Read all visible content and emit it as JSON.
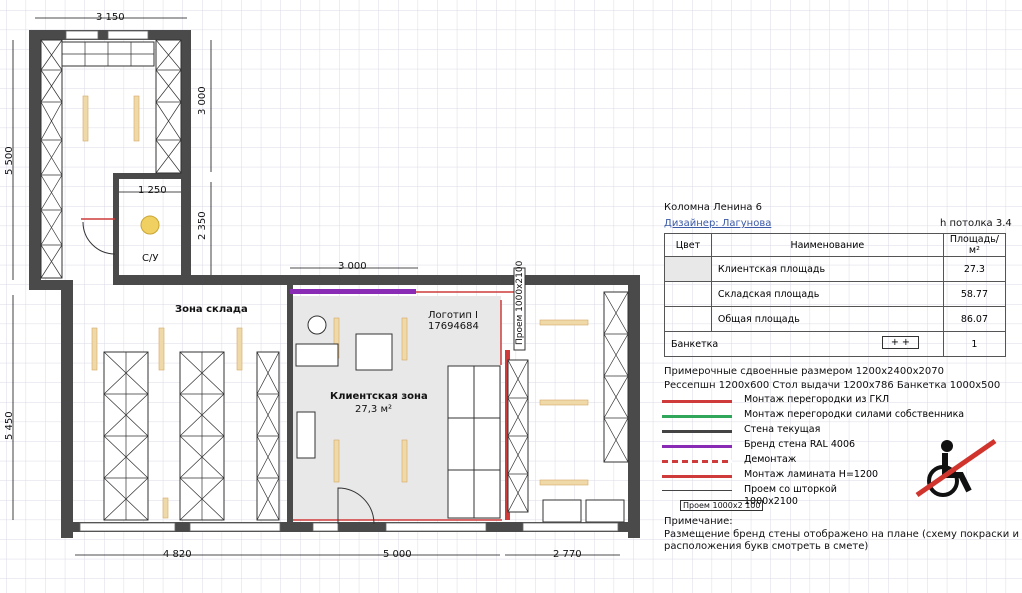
{
  "dimensions": {
    "top_width": "3 150",
    "left_height": "5 500",
    "storage_height": "3 000",
    "wc_width": "1 250",
    "wc_height": "2 350",
    "client_top": "3 000",
    "bottom_height": "5 450",
    "bottom_left": "4 820",
    "bottom_mid": "5 000",
    "bottom_right": "2 770",
    "opening_vertical": "Проем 1000х2100"
  },
  "rooms": {
    "wc": "С/У",
    "storage": "Зона склада",
    "client_zone": "Клиентская зона",
    "client_area": "27,3 м²",
    "logo_label": "Логотип I",
    "logo_code": "17694684"
  },
  "info": {
    "address": "Коломна Ленина 6",
    "designer": "Дизайнер: Лагунова",
    "ceiling": "h потолка 3.4"
  },
  "table": {
    "headers": [
      "Цвет",
      "Наименование",
      "Площадь/м²"
    ],
    "rows": [
      {
        "name": "Клиентская площадь",
        "value": "27.3"
      },
      {
        "name": "Складская площадь",
        "value": "58.77"
      },
      {
        "name": "Общая площадь",
        "value": "86.07"
      }
    ],
    "bench": {
      "name": "Банкетка",
      "value": "1",
      "symbol": "+ +"
    }
  },
  "notes": {
    "fitting_rooms": "Примерочные сдвоенные размером 1200х2400х2070",
    "furniture": "Рессепшн 1200х600   Стол выдачи 1200х786   Банкетка 1000х500"
  },
  "legend": [
    {
      "label": "Монтаж перегородки из ГКЛ",
      "color": "#cf3b3b"
    },
    {
      "label": "Монтаж перегородки силами собственника",
      "color": "#2fa65a"
    },
    {
      "label": "Стена текущая",
      "color": "#444444"
    },
    {
      "label": "Бренд стена RAL 4006",
      "color": "#8a2bb5"
    },
    {
      "label": "Демонтаж",
      "color": "#cf3b3b"
    },
    {
      "label": "Монтаж ламината Н=1200",
      "color": "#cf3b3b"
    },
    {
      "label": "Проем со шторкой",
      "color": "#444444"
    },
    {
      "label": "1000х2100",
      "color": "#444444"
    }
  ],
  "opening_label": "Проем 1000х2 100",
  "remark": {
    "title": "Примечание:",
    "line1": "Размещение бренд стены отображено на плане (схему покраски и",
    "line2": "расположения букв смотреть в смете)"
  },
  "colors": {
    "wall": "#4a4a4a",
    "grid": "#d9d9e6",
    "client_floor": "#e8e8e8",
    "partition": "#cf3b3b",
    "brand": "#8a2bb5",
    "lamp": "#f0d9a8"
  }
}
